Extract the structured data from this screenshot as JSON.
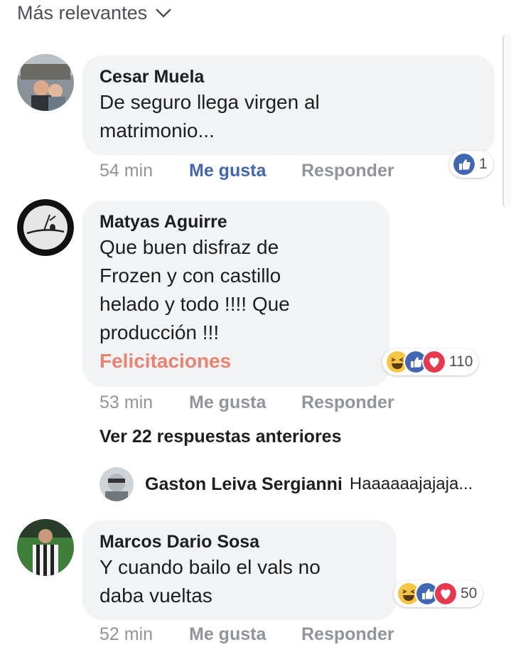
{
  "sort": {
    "label": "Más relevantes"
  },
  "colors": {
    "like_blue": "#4267b2",
    "bubble_bg": "#f2f3f5",
    "meta_gray": "#90949c",
    "felicitaciones": "#e9836f"
  },
  "comments": [
    {
      "author": "Cesar Muela",
      "lines": [
        "De seguro llega virgen al",
        "matrimonio..."
      ],
      "time": "54 min",
      "like_label": "Me gusta",
      "reply_label": "Responder",
      "reactions": {
        "icons": [
          "like-icon"
        ],
        "count": "1"
      },
      "liked": true
    },
    {
      "author": "Matyas Aguirre",
      "lines": [
        "Que buen disfraz de",
        "Frozen y con castillo",
        "helado y todo !!!! Que",
        "producción !!!"
      ],
      "extra": "Felicitaciones",
      "time": "53 min",
      "like_label": "Me gusta",
      "reply_label": "Responder",
      "reactions": {
        "icons": [
          "haha-icon",
          "like-icon",
          "love-icon"
        ],
        "count": "110"
      },
      "liked": false
    },
    {
      "author": "Marcos Dario Sosa",
      "lines": [
        "Y cuando bailo el vals no",
        "daba vueltas"
      ],
      "time": "52 min",
      "like_label": "Me gusta",
      "reply_label": "Responder",
      "reactions": {
        "icons": [
          "haha-icon",
          "like-icon",
          "love-icon"
        ],
        "count": "50"
      },
      "liked": false
    }
  ],
  "replies": {
    "previous_label": "Ver 22 respuestas anteriores",
    "latest": {
      "author": "Gaston Leiva Sergianni",
      "text": "Haaaaaajajaja..."
    }
  }
}
